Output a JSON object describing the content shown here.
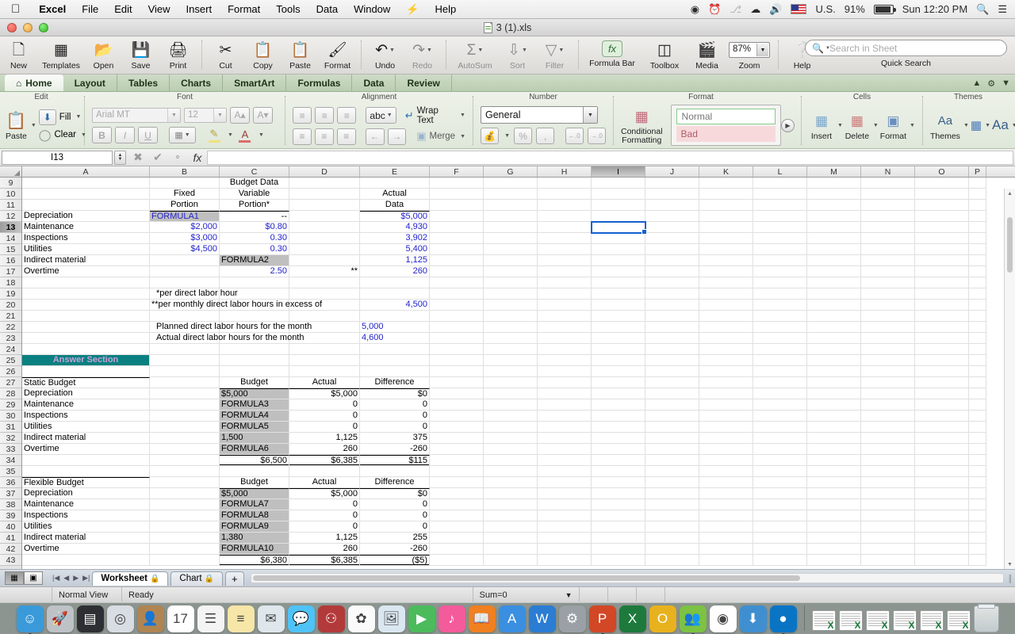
{
  "menubar": {
    "apple": "apple-logo",
    "items": [
      "Excel",
      "File",
      "Edit",
      "View",
      "Insert",
      "Format",
      "Tools",
      "Data",
      "Window",
      "Help"
    ],
    "status": {
      "bluetooth": "bluetooth-icon",
      "wifi": "wifi-icon",
      "volume": "volume-icon",
      "input_source": "U.S.",
      "battery_percent": "91%",
      "clock": "Sun 12:20 PM",
      "spotlight": "search-icon",
      "notification_center": "list-icon"
    }
  },
  "window": {
    "title": "3 (1).xls"
  },
  "toolbar": {
    "items": [
      {
        "label": "New",
        "icon": "new-document-icon"
      },
      {
        "label": "Templates",
        "icon": "templates-icon"
      },
      {
        "label": "Open",
        "icon": "open-folder-icon"
      },
      {
        "label": "Save",
        "icon": "save-floppy-icon"
      },
      {
        "label": "Print",
        "icon": "printer-icon"
      },
      {
        "label": "Cut",
        "icon": "scissors-icon"
      },
      {
        "label": "Copy",
        "icon": "copy-icon"
      },
      {
        "label": "Paste",
        "icon": "paste-icon"
      },
      {
        "label": "Format",
        "icon": "format-brush-icon"
      },
      {
        "label": "Undo",
        "icon": "undo-arrow-icon"
      },
      {
        "label": "Redo",
        "icon": "redo-arrow-icon"
      },
      {
        "label": "AutoSum",
        "icon": "sigma-icon"
      },
      {
        "label": "Sort",
        "icon": "sort-az-icon"
      },
      {
        "label": "Filter",
        "icon": "funnel-icon"
      },
      {
        "label": "Formula Bar",
        "icon": "fx-icon"
      },
      {
        "label": "Toolbox",
        "icon": "toolbox-icon"
      },
      {
        "label": "Media",
        "icon": "media-icon"
      },
      {
        "label": "Zoom",
        "icon": "zoom-icon"
      },
      {
        "label": "Help",
        "icon": "help-question-icon"
      }
    ],
    "zoom_value": "87%",
    "search_placeholder": "Search in Sheet",
    "quick_search_label": "Quick Search"
  },
  "ribbon": {
    "tabs": [
      {
        "label": "Home",
        "icon": "home-icon",
        "active": true
      },
      {
        "label": "Layout",
        "active": false
      },
      {
        "label": "Tables",
        "active": false
      },
      {
        "label": "Charts",
        "active": false
      },
      {
        "label": "SmartArt",
        "active": false
      },
      {
        "label": "Formulas",
        "active": false
      },
      {
        "label": "Data",
        "active": false
      },
      {
        "label": "Review",
        "active": false
      }
    ],
    "groups": {
      "edit": {
        "title": "Edit",
        "paste": "Paste",
        "fill": "Fill",
        "clear": "Clear"
      },
      "font": {
        "title": "Font",
        "font_name": "Arial MT",
        "font_size": "12",
        "grow": "A",
        "shrink": "A",
        "bold": "B",
        "italic": "I",
        "underline": "U",
        "borders": "borders-icon",
        "fill_color": "fill-color-icon",
        "font_color": "font-color-icon"
      },
      "alignment": {
        "title": "Alignment",
        "orientation": "abc",
        "wrap_text": "Wrap Text",
        "merge": "Merge"
      },
      "number": {
        "title": "Number",
        "format": "General",
        "currency": "currency-icon",
        "percent": "%",
        "comma": ",",
        "decrease_decimal": ".00",
        "increase_decimal": ".00"
      },
      "format": {
        "title": "Format",
        "conditional_formatting": "Conditional Formatting",
        "style_normal": "Normal",
        "style_bad": "Bad"
      },
      "cells": {
        "title": "Cells",
        "insert": "Insert",
        "delete": "Delete",
        "format": "Format"
      },
      "themes": {
        "title": "Themes",
        "themes": "Themes",
        "fonts": "Aa"
      }
    }
  },
  "formula_bar": {
    "name_box": "I13",
    "cancel": "cancel-icon",
    "accept": "accept-icon",
    "function": "fx",
    "content": ""
  },
  "sheet": {
    "columns": [
      "A",
      "B",
      "C",
      "D",
      "E",
      "F",
      "G",
      "H",
      "I",
      "J",
      "K",
      "L",
      "M",
      "N",
      "O",
      "P"
    ],
    "selected_column": "I",
    "selected_row": "13",
    "selected_cell": "I13",
    "rows": [
      {
        "n": "9",
        "cells": {
          "C": "Budget Data"
        }
      },
      {
        "n": "10",
        "cells": {
          "B": "Fixed",
          "C": "Variable",
          "E": "Actual"
        }
      },
      {
        "n": "11",
        "cells": {
          "B": "Portion",
          "C": "Portion*",
          "E": "Data"
        }
      },
      {
        "n": "12",
        "cells": {
          "A": "Depreciation",
          "B": "FORMULA1",
          "C": "--",
          "E": "$5,000"
        }
      },
      {
        "n": "13",
        "cells": {
          "A": "Maintenance",
          "B": "$2,000",
          "C": "$0.80",
          "E": "4,930"
        }
      },
      {
        "n": "14",
        "cells": {
          "A": "Inspections",
          "B": "$3,000",
          "C": "0.30",
          "E": "3,902"
        }
      },
      {
        "n": "15",
        "cells": {
          "A": "Utilities",
          "B": "$4,500",
          "C": "0.30",
          "E": "5,400"
        }
      },
      {
        "n": "16",
        "cells": {
          "A": "Indirect material",
          "C": "FORMULA2",
          "E": "1,125"
        }
      },
      {
        "n": "17",
        "cells": {
          "A": "Overtime",
          "C": "2.50",
          "D": "**",
          "E": "260"
        }
      },
      {
        "n": "18",
        "cells": {}
      },
      {
        "n": "19",
        "cells": {
          "B": "*per direct labor hour"
        }
      },
      {
        "n": "20",
        "cells": {
          "B": "**per monthly direct labor hours in excess of",
          "E": "4,500"
        }
      },
      {
        "n": "21",
        "cells": {}
      },
      {
        "n": "22",
        "cells": {
          "B": "Planned direct labor hours for the month",
          "E": "5,000"
        }
      },
      {
        "n": "23",
        "cells": {
          "B": "Actual direct labor hours for the month",
          "E": "4,600"
        }
      },
      {
        "n": "24",
        "cells": {}
      },
      {
        "n": "25",
        "cells": {
          "A": "Answer Section"
        }
      },
      {
        "n": "26",
        "cells": {}
      },
      {
        "n": "27",
        "cells": {
          "A": "Static Budget",
          "C": "Budget",
          "D": "Actual",
          "E": "Difference"
        }
      },
      {
        "n": "28",
        "cells": {
          "A": "Depreciation",
          "C": "$5,000",
          "D": "$5,000",
          "E": "$0"
        }
      },
      {
        "n": "29",
        "cells": {
          "A": "Maintenance",
          "C": "FORMULA3",
          "D": "0",
          "E": "0"
        }
      },
      {
        "n": "30",
        "cells": {
          "A": "Inspections",
          "C": "FORMULA4",
          "D": "0",
          "E": "0"
        }
      },
      {
        "n": "31",
        "cells": {
          "A": "Utilities",
          "C": "FORMULA5",
          "D": "0",
          "E": "0"
        }
      },
      {
        "n": "32",
        "cells": {
          "A": "Indirect material",
          "C": "1,500",
          "D": "1,125",
          "E": "375"
        }
      },
      {
        "n": "33",
        "cells": {
          "A": "Overtime",
          "C": "FORMULA6",
          "D": "260",
          "E": "-260"
        }
      },
      {
        "n": "34",
        "cells": {
          "C": "$6,500",
          "D": "$6,385",
          "E": "$115"
        }
      },
      {
        "n": "35",
        "cells": {}
      },
      {
        "n": "36",
        "cells": {
          "A": "Flexible Budget",
          "C": "Budget",
          "D": "Actual",
          "E": "Difference"
        }
      },
      {
        "n": "37",
        "cells": {
          "A": "Depreciation",
          "C": "$5,000",
          "D": "$5,000",
          "E": "$0"
        }
      },
      {
        "n": "38",
        "cells": {
          "A": "Maintenance",
          "C": "FORMULA7",
          "D": "0",
          "E": "0"
        }
      },
      {
        "n": "39",
        "cells": {
          "A": "Inspections",
          "C": "FORMULA8",
          "D": "0",
          "E": "0"
        }
      },
      {
        "n": "40",
        "cells": {
          "A": "Utilities",
          "C": "FORMULA9",
          "D": "0",
          "E": "0"
        }
      },
      {
        "n": "41",
        "cells": {
          "A": "Indirect material",
          "C": "1,380",
          "D": "1,125",
          "E": "255"
        }
      },
      {
        "n": "42",
        "cells": {
          "A": "Overtime",
          "C": "FORMULA10",
          "D": "260",
          "E": "-260"
        }
      },
      {
        "n": "43",
        "cells": {
          "C": "$6,380",
          "D": "$6,385",
          "E": "($5)"
        }
      }
    ]
  },
  "tabbar": {
    "view_normal": "normal-view-icon",
    "view_layout": "page-layout-icon",
    "nav_first": "|◀",
    "nav_prev": "◀",
    "nav_next": "▶",
    "nav_last": "▶|",
    "sheets": [
      {
        "label": "Worksheet",
        "locked": true,
        "active": true
      },
      {
        "label": "Chart",
        "locked": true,
        "active": false
      }
    ],
    "add_sheet": "+"
  },
  "statusbar": {
    "view_mode": "Normal View",
    "state": "Ready",
    "sum": "Sum=0"
  },
  "dock": {
    "left_apps": [
      {
        "name": "finder-icon",
        "color": "#3a9ad9",
        "glyph": "☺",
        "running": true
      },
      {
        "name": "launchpad-icon",
        "color": "#bcc2c6",
        "glyph": "🚀",
        "running": false
      },
      {
        "name": "mission-control-icon",
        "color": "#2d2f33",
        "glyph": "▤",
        "running": false
      },
      {
        "name": "safari-icon",
        "color": "#d7dde2",
        "glyph": "◎",
        "running": false
      },
      {
        "name": "contacts-icon",
        "color": "#b08552",
        "glyph": "👤",
        "running": false
      },
      {
        "name": "calendar-icon",
        "color": "#ffffff",
        "glyph": "17",
        "running": false
      },
      {
        "name": "reminders-icon",
        "color": "#f4f4f4",
        "glyph": "☰",
        "running": false
      },
      {
        "name": "notes-icon",
        "color": "#f6e6a8",
        "glyph": "≡",
        "running": false
      },
      {
        "name": "mail-icon",
        "color": "#dfe6ec",
        "glyph": "✉",
        "running": false
      },
      {
        "name": "messages-icon",
        "color": "#4fc3f7",
        "glyph": "💬",
        "running": false
      },
      {
        "name": "photobooth-icon",
        "color": "#b33a3a",
        "glyph": "⚇",
        "running": false
      },
      {
        "name": "photos-icon",
        "color": "#fafafa",
        "glyph": "✿",
        "running": false
      },
      {
        "name": "preview-icon",
        "color": "#dbe7f0",
        "glyph": "🖼",
        "running": false
      },
      {
        "name": "facetime-icon",
        "color": "#4cbb5c",
        "glyph": "▶",
        "running": false
      },
      {
        "name": "itunes-icon",
        "color": "#f45b9b",
        "glyph": "♪",
        "running": false
      },
      {
        "name": "ibooks-icon",
        "color": "#f08020",
        "glyph": "📖",
        "running": false
      },
      {
        "name": "app-store-icon",
        "color": "#3a8fe0",
        "glyph": "A",
        "running": false
      },
      {
        "name": "word-icon",
        "color": "#2b7cd3",
        "glyph": "W",
        "running": false
      },
      {
        "name": "system-preferences-icon",
        "color": "#9aa0a6",
        "glyph": "⚙",
        "running": false
      },
      {
        "name": "powerpoint-icon",
        "color": "#d24726",
        "glyph": "P",
        "running": true
      },
      {
        "name": "excel-icon",
        "color": "#1d7a3c",
        "glyph": "X",
        "running": false
      },
      {
        "name": "outlook-icon",
        "color": "#e8b21e",
        "glyph": "O",
        "running": false
      },
      {
        "name": "messenger-icon",
        "color": "#7cc243",
        "glyph": "👥",
        "running": true
      },
      {
        "name": "chrome-icon",
        "color": "#ffffff",
        "glyph": "◉",
        "running": false
      },
      {
        "name": "downloads-icon",
        "color": "#3f8fd0",
        "glyph": "⬇",
        "running": false
      },
      {
        "name": "onedrive-icon",
        "color": "#0a74c4",
        "glyph": "●",
        "running": true
      }
    ],
    "minimized_windows": 6,
    "trash": "trash-icon"
  }
}
